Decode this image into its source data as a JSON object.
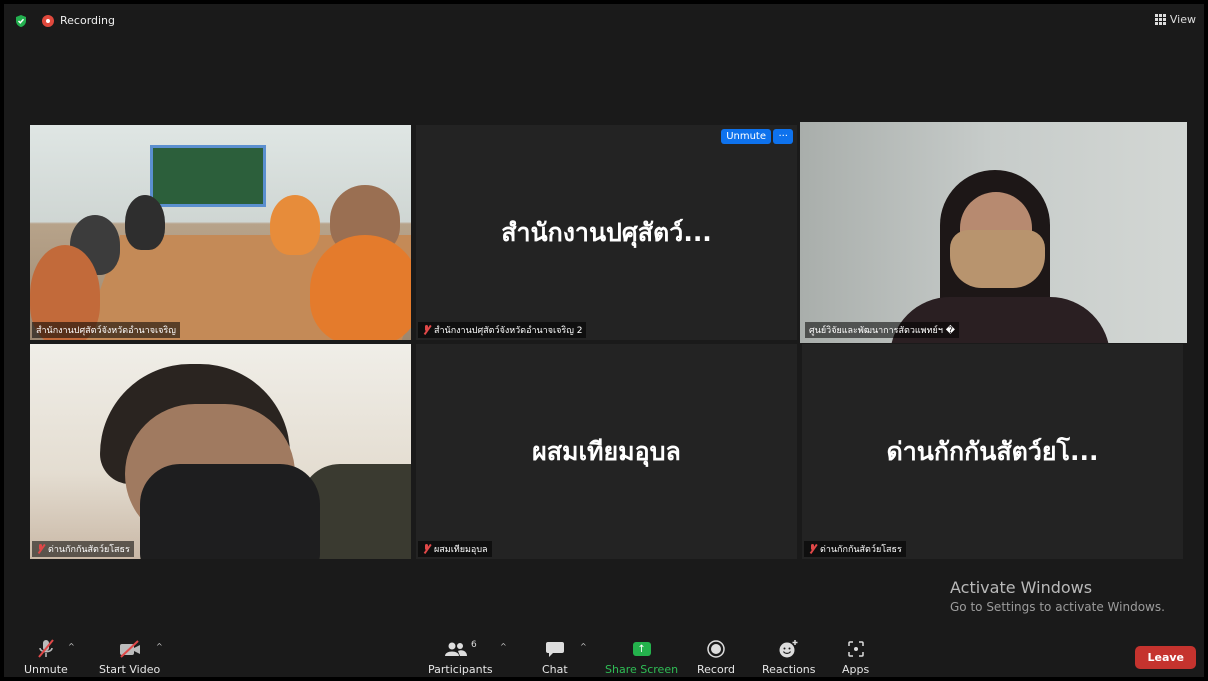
{
  "status": {
    "recording_label": "Recording",
    "view_label": "View"
  },
  "tiles": [
    {
      "name": "สำนักงานปศุสัตว์จังหวัดอำนาจเจริญ",
      "kind": "video-meeting-room",
      "muted": false
    },
    {
      "name": "สำนักงานปศุสัตว์จังหวัดอำนาจเจริญ 2",
      "display": "สำนักงานปศุสัตว์...",
      "muted": true,
      "hover_unmute": "Unmute",
      "hover_more": "···"
    },
    {
      "name": "ศูนย์วิจัยและพัฒนาการสัตวแพทย์ฯ �",
      "kind": "video-person",
      "active_speaker": true,
      "muted": false
    },
    {
      "name": "ด่านกักกันสัตว์ยโสธร",
      "kind": "video-person",
      "muted": true
    },
    {
      "name": "ผสมเทียมอุบล",
      "display": "ผสมเทียมอุบล",
      "muted": true
    },
    {
      "name": "ด่านกักกันสัตว์ยโสธร",
      "display": "ด่านกักกันสัตว์ยโ...",
      "muted": true
    }
  ],
  "watermark": {
    "title": "Activate Windows",
    "subtitle": "Go to Settings to activate Windows."
  },
  "toolbar": {
    "unmute": "Unmute",
    "start_video": "Start Video",
    "participants": "Participants",
    "participants_count": "6",
    "chat": "Chat",
    "share_screen": "Share Screen",
    "record": "Record",
    "reactions": "Reactions",
    "apps": "Apps",
    "leave": "Leave"
  },
  "colors": {
    "accent_blue": "#0e72ed",
    "share_green": "#24b24c",
    "leave_red": "#c5332e",
    "active_outline": "#d9e58a"
  }
}
